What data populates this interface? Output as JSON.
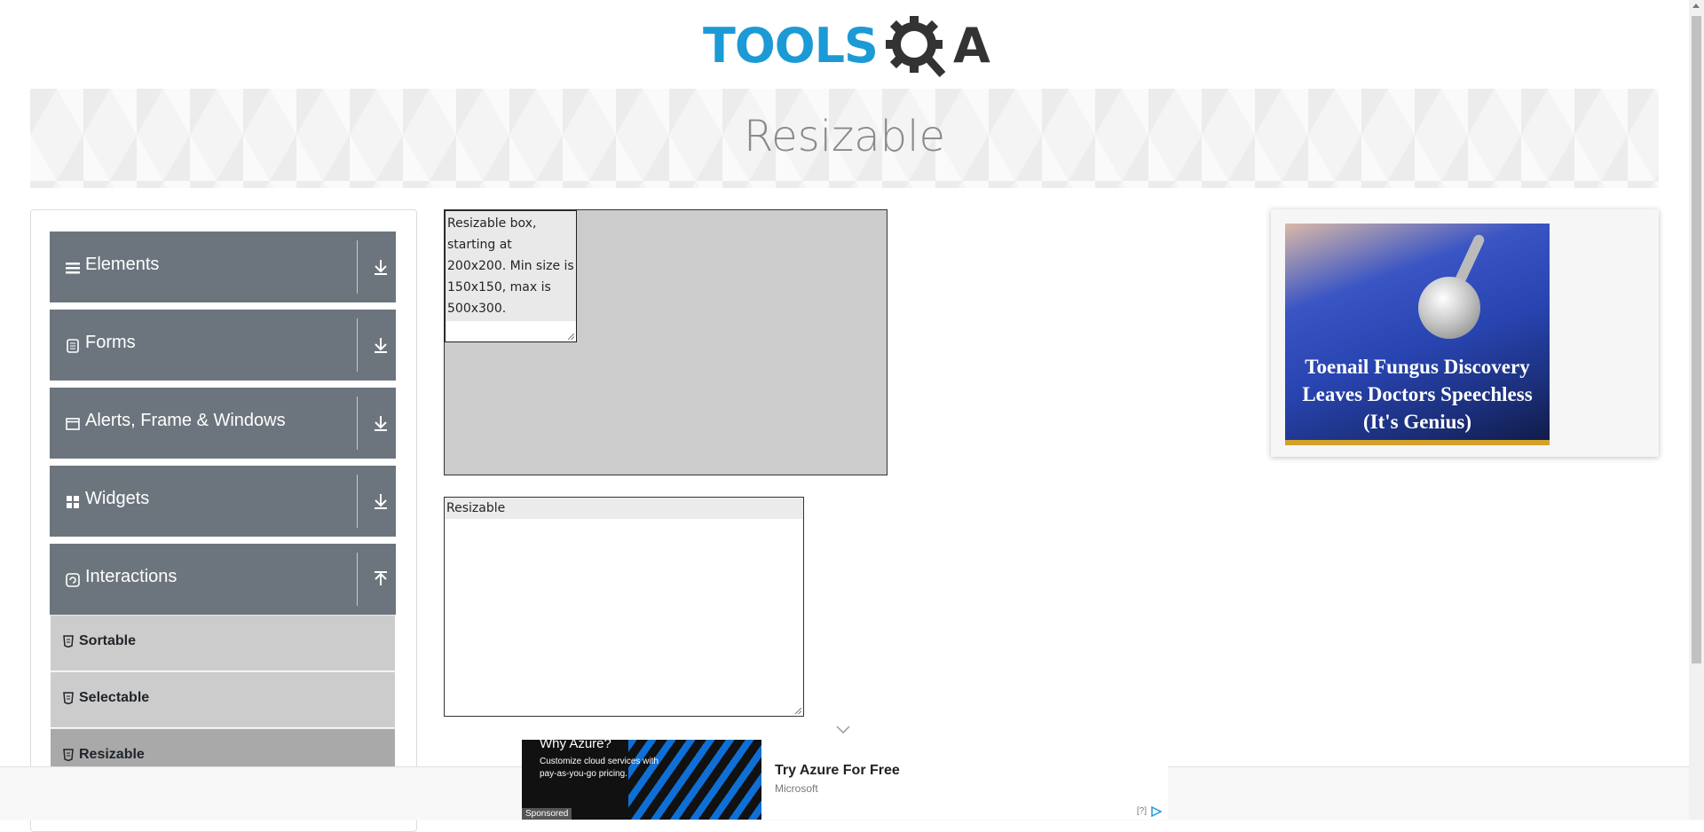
{
  "logo": {
    "part1": "TOOLS",
    "part2": "A"
  },
  "banner": {
    "title": "Resizable"
  },
  "sidebar": {
    "groups": [
      {
        "label": "Elements",
        "icon": "hamburger-icon"
      },
      {
        "label": "Forms",
        "icon": "document-icon"
      },
      {
        "label": "Alerts, Frame & Windows",
        "icon": "window-icon"
      },
      {
        "label": "Widgets",
        "icon": "grid-icon"
      },
      {
        "label": "Interactions",
        "icon": "refresh-icon"
      }
    ],
    "items": [
      {
        "label": "Sortable"
      },
      {
        "label": "Selectable"
      },
      {
        "label": "Resizable"
      }
    ]
  },
  "main": {
    "restricted_box_text": "Resizable box, starting at 200x200. Min size is 150x150, max is 500x300.",
    "free_box_text": "Resizable"
  },
  "ad_right": {
    "caption": "Toenail Fungus Discovery Leaves Doctors Speechless (It's Genius)"
  },
  "ad_bottom": {
    "image_heading": "Why Azure?",
    "image_desc": "Customize cloud services with pay-as-you-go pricing.",
    "sponsored": "Sponsored",
    "title": "Try Azure For Free",
    "brand": "Microsoft",
    "info": "[?]"
  },
  "colors": {
    "accent_blue": "#1b9ad6",
    "group_header": "#6c757d",
    "menu_item": "#cccccc",
    "menu_item_active": "#a9a9a9"
  }
}
